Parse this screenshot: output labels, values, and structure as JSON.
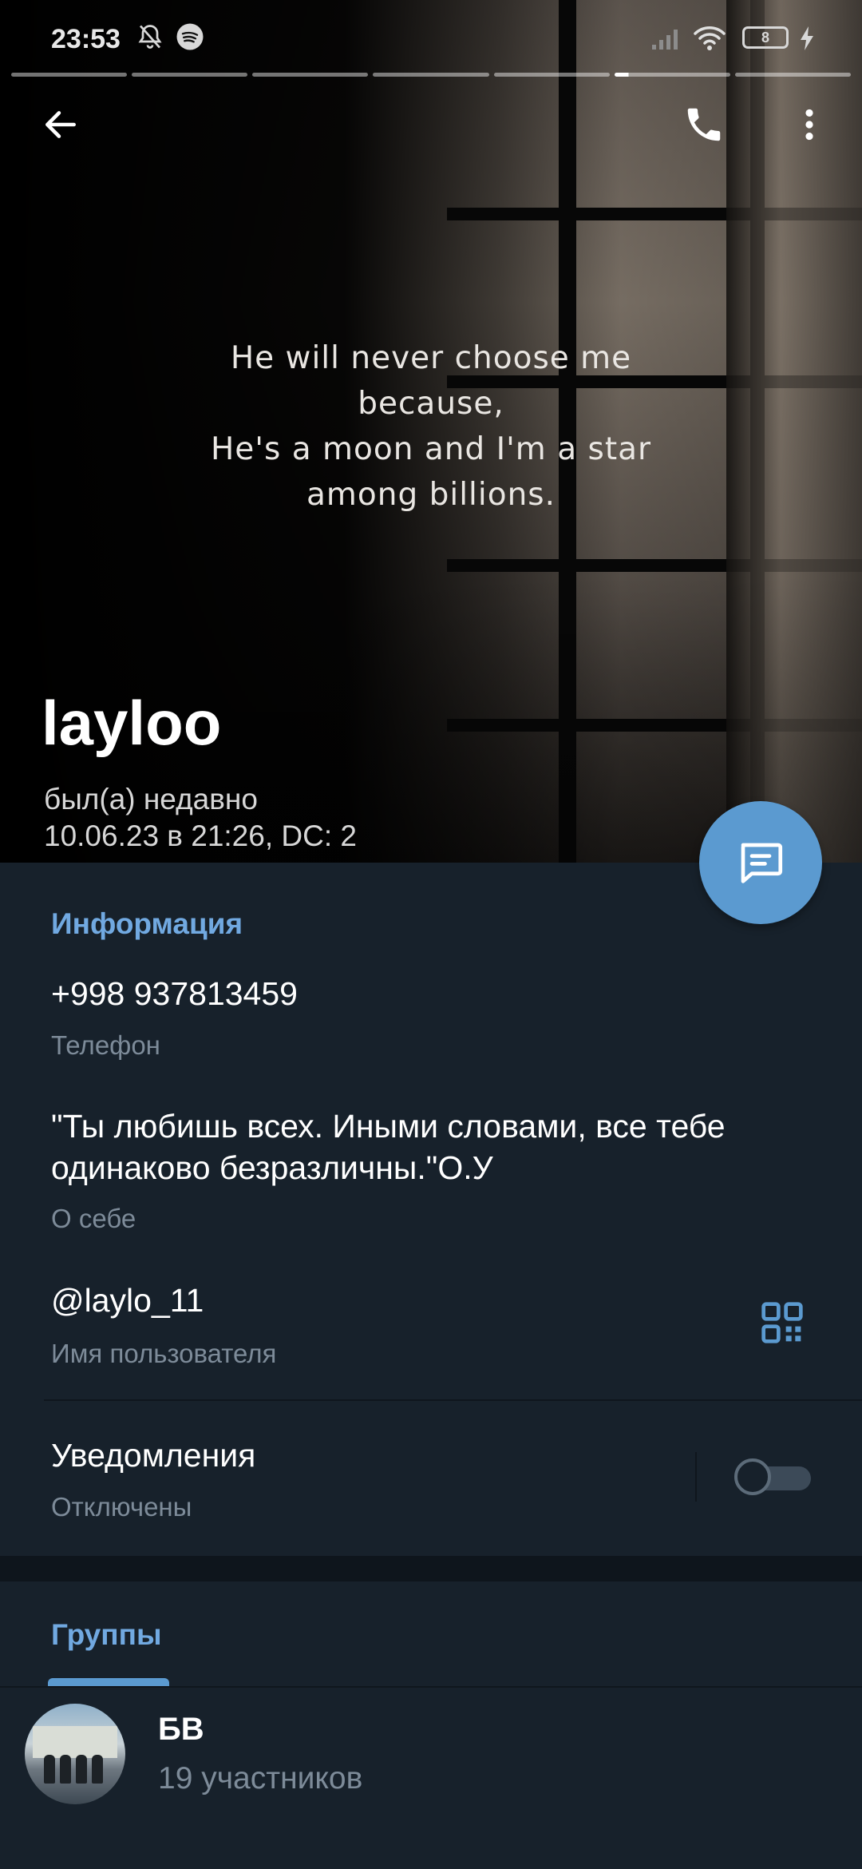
{
  "status_bar": {
    "time": "23:53",
    "icons": [
      "bell-off-icon",
      "spotify-icon",
      "signal-icon",
      "wifi-icon",
      "battery-icon",
      "charging-icon"
    ],
    "battery_level": "8"
  },
  "story": {
    "segments": 7,
    "active_index": 5
  },
  "top_bar": {
    "back_icon": "arrow-left-icon",
    "call_icon": "phone-icon",
    "menu_icon": "more-vertical-icon"
  },
  "photo": {
    "quote_lines": [
      "He will never choose me",
      "because,",
      "He's a moon and I'm a star",
      "among billions."
    ]
  },
  "profile": {
    "name": "layloo",
    "status_line1": "был(а) недавно",
    "status_line2": "10.06.23 в 21:26, DC: 2"
  },
  "fab": {
    "icon": "message-icon"
  },
  "info": {
    "title": "Информация",
    "phone": {
      "value": "+998 937813459",
      "label": "Телефон"
    },
    "bio": {
      "line1": "\"Ты любишь всех. Иными словами, все тебе",
      "line2": "одинаково безразличны.\"О.У",
      "label": "О себе"
    },
    "username": {
      "value": "@laylo_11",
      "label": "Имя пользователя",
      "icon": "qr-code-icon"
    },
    "notifications": {
      "value": "Уведомления",
      "label": "Отключены",
      "enabled": false
    }
  },
  "groups": {
    "title": "Группы",
    "items": [
      {
        "name": "БВ",
        "members": "19 участников"
      }
    ]
  },
  "colors": {
    "background": "#17212b",
    "accent": "#5b9ad0",
    "section_title": "#71a9e1",
    "secondary_text": "#7d8b99"
  }
}
